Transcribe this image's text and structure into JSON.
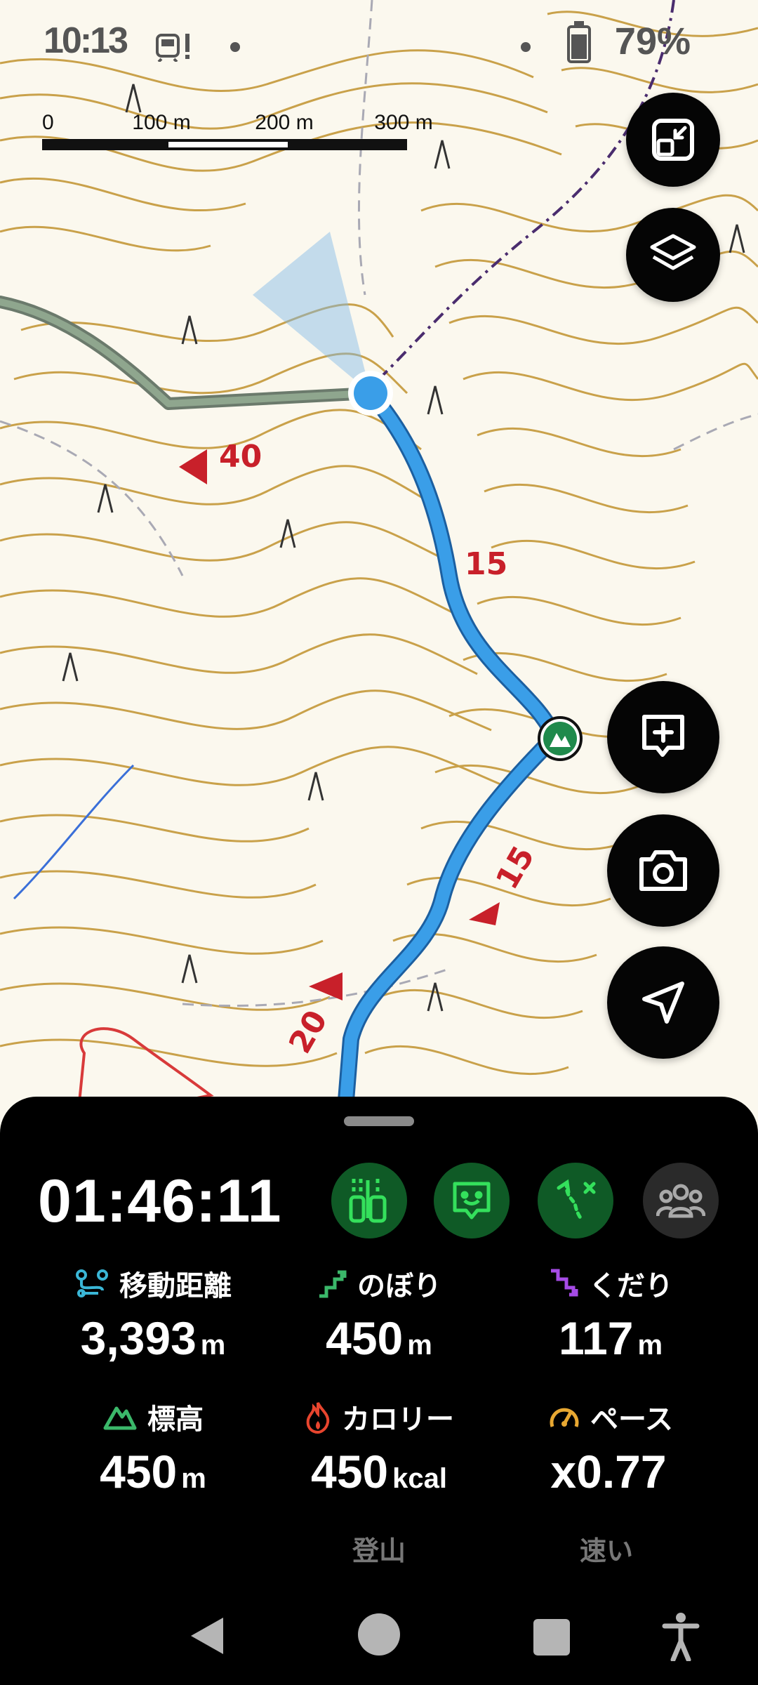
{
  "status_bar": {
    "time": "10:13",
    "battery": "79%"
  },
  "scale_bar": {
    "labels": [
      "0",
      "100 m",
      "200 m",
      "300 m"
    ]
  },
  "map": {
    "contour_color": "#c9a14a",
    "route_color": "#3a9ee8",
    "marker_labels": [
      "40",
      "15",
      "15",
      "20"
    ]
  },
  "floating_buttons": [
    {
      "icon": "collapse-map-icon"
    },
    {
      "icon": "layers-icon"
    },
    {
      "icon": "add-note-icon"
    },
    {
      "icon": "camera-icon"
    },
    {
      "icon": "navigate-icon"
    }
  ],
  "activity": {
    "elapsed": "01:46:11",
    "action_icons": [
      "equipment-icon",
      "message-icon",
      "route-off-icon",
      "group-icon"
    ],
    "stats": [
      {
        "label": "移動距離",
        "value": "3,393",
        "unit": "m",
        "icon": "distance-icon",
        "icon_color": "#3ab6d6"
      },
      {
        "label": "のぼり",
        "value": "450",
        "unit": "m",
        "icon": "ascent-icon",
        "icon_color": "#3bb86a"
      },
      {
        "label": "くだり",
        "value": "117",
        "unit": "m",
        "icon": "descent-icon",
        "icon_color": "#a64be6"
      },
      {
        "label": "標高",
        "value": "450",
        "unit": "m",
        "icon": "elevation-icon",
        "icon_color": "#3bb86a"
      },
      {
        "label": "カロリー",
        "value": "450",
        "unit": "kcal",
        "icon": "flame-icon",
        "icon_color": "#e8452e"
      },
      {
        "label": "ペース",
        "value": "x0.77",
        "unit": "",
        "icon": "speedometer-icon",
        "icon_color": "#e8a832"
      }
    ],
    "calorie_note": "登山",
    "pace_note": "速い"
  }
}
